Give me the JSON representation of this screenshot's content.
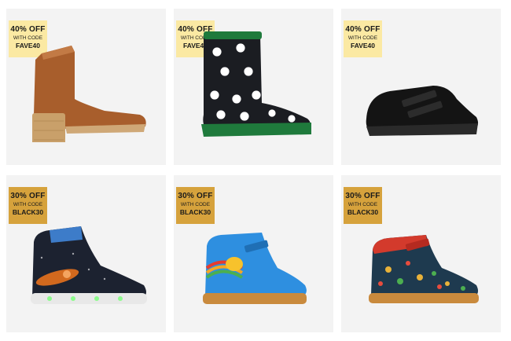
{
  "products": [
    {
      "badge": {
        "discount": "40% OFF",
        "with_code": "WITH CODE",
        "code": "FAVE40"
      },
      "image": "tan-suede-heeled-ankle-boot"
    },
    {
      "badge": {
        "discount": "40% OFF",
        "with_code": "WITH CODE",
        "code": "FAVE40"
      },
      "image": "football-print-wellington-boot"
    },
    {
      "badge": {
        "discount": "40% OFF",
        "with_code": "WITH CODE",
        "code": "FAVE40"
      },
      "image": "black-leather-school-shoe"
    },
    {
      "badge": {
        "discount": "30% OFF",
        "with_code": "WITH CODE",
        "code": "BLACK30"
      },
      "image": "space-light-up-hi-top-trainer"
    },
    {
      "badge": {
        "discount": "30% OFF",
        "with_code": "WITH CODE",
        "code": "BLACK30"
      },
      "image": "blue-bee-rainbow-hi-top-boot"
    },
    {
      "badge": {
        "discount": "30% OFF",
        "with_code": "WITH CODE",
        "code": "BLACK30"
      },
      "image": "red-floral-print-hi-top-boot"
    }
  ],
  "colors": {
    "badge_fave": "#fbe9a3",
    "badge_black": "#d6a23c",
    "card_bg": "#f3f3f3"
  }
}
